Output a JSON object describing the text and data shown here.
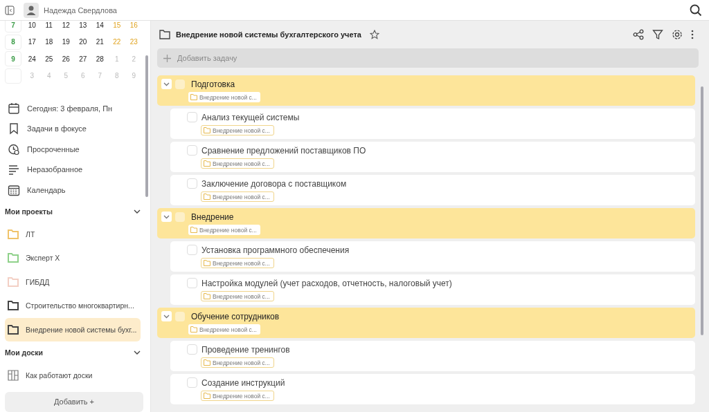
{
  "user": {
    "name": "Надежда Свердлова"
  },
  "calendar": [
    {
      "week": "7",
      "days": [
        {
          "text": "10",
          "kind": "work"
        },
        {
          "text": "11",
          "kind": "work"
        },
        {
          "text": "12",
          "kind": "work"
        },
        {
          "text": "13",
          "kind": "work"
        },
        {
          "text": "14",
          "kind": "work"
        },
        {
          "text": "15",
          "kind": "weekend"
        },
        {
          "text": "16",
          "kind": "weekend"
        }
      ]
    },
    {
      "week": "8",
      "days": [
        {
          "text": "17",
          "kind": "work"
        },
        {
          "text": "18",
          "kind": "work"
        },
        {
          "text": "19",
          "kind": "work"
        },
        {
          "text": "20",
          "kind": "work"
        },
        {
          "text": "21",
          "kind": "work"
        },
        {
          "text": "22",
          "kind": "weekend"
        },
        {
          "text": "23",
          "kind": "weekend"
        }
      ]
    },
    {
      "week": "9",
      "days": [
        {
          "text": "24",
          "kind": "work"
        },
        {
          "text": "25",
          "kind": "work"
        },
        {
          "text": "26",
          "kind": "work"
        },
        {
          "text": "27",
          "kind": "work"
        },
        {
          "text": "28",
          "kind": "work"
        },
        {
          "text": "1",
          "kind": "other"
        },
        {
          "text": "2",
          "kind": "other"
        }
      ]
    },
    {
      "days": [
        {
          "text": "3",
          "kind": "other"
        },
        {
          "text": "4",
          "kind": "other"
        },
        {
          "text": "5",
          "kind": "other"
        },
        {
          "text": "6",
          "kind": "other"
        },
        {
          "text": "7",
          "kind": "other"
        },
        {
          "text": "8",
          "kind": "other"
        },
        {
          "text": "9",
          "kind": "other"
        }
      ]
    }
  ],
  "nav": [
    {
      "label": "Сегодня: 3 февраля, Пн",
      "kind": "today"
    },
    {
      "label": "Задачи в фокусе",
      "kind": "focus"
    },
    {
      "label": "Просроченные",
      "kind": "overdue"
    },
    {
      "label": "Неразобранное",
      "kind": "inbox"
    },
    {
      "label": "Календарь",
      "kind": "calendar"
    }
  ],
  "projects_section": {
    "title": "Мои проекты",
    "expanded": true
  },
  "projects": [
    {
      "label": "ЛТ",
      "color": "#f0c36a",
      "selected": false
    },
    {
      "label": "Эксперт X",
      "color": "#8fd18a",
      "selected": false
    },
    {
      "label": "ГИБДД",
      "color": "#f3cfc4",
      "selected": false
    },
    {
      "label": "Строительство многоквартирн...",
      "color": "#444444",
      "selected": false
    },
    {
      "label": "Внедрение новой системы бухг...",
      "color": "#444444",
      "selected": true
    }
  ],
  "boards_section": {
    "title": "Мои доски",
    "expanded": true
  },
  "boards": [
    {
      "label": "Как работают доски"
    }
  ],
  "add_button": "Добавить +",
  "header": {
    "title": "Внедрение новой системы бухгалтерского учета",
    "starred": false
  },
  "add_task": {
    "placeholder": "Добавить задачу"
  },
  "groups": [
    {
      "title": "Подготовка",
      "tag": "Внедрение новой с...",
      "expanded": true,
      "checked": false,
      "tasks": [
        {
          "title": "Анализ текущей системы",
          "tag": "Внедрение новой с...",
          "checked": false
        },
        {
          "title": "Сравнение предложений поставщиков ПО",
          "tag": "Внедрение новой с...",
          "checked": false
        },
        {
          "title": "Заключение договора с поставщиком",
          "tag": "Внедрение новой с...",
          "checked": false
        }
      ]
    },
    {
      "title": "Внедрение",
      "tag": "Внедрение новой с...",
      "expanded": true,
      "checked": false,
      "tasks": [
        {
          "title": "Установка программного обеспечения",
          "tag": "Внедрение новой с...",
          "checked": false
        },
        {
          "title": "Настройка модулей (учет расходов, отчетность, налоговый учет)",
          "tag": "Внедрение новой с...",
          "checked": false
        }
      ]
    },
    {
      "title": "Обучение сотрудников",
      "tag": "Внедрение новой с...",
      "expanded": true,
      "checked": false,
      "tasks": [
        {
          "title": "Проведение тренингов",
          "tag": "Внедрение новой с...",
          "checked": false
        },
        {
          "title": "Создание инструкций",
          "tag": "Внедрение новой с...",
          "checked": false
        }
      ]
    }
  ]
}
